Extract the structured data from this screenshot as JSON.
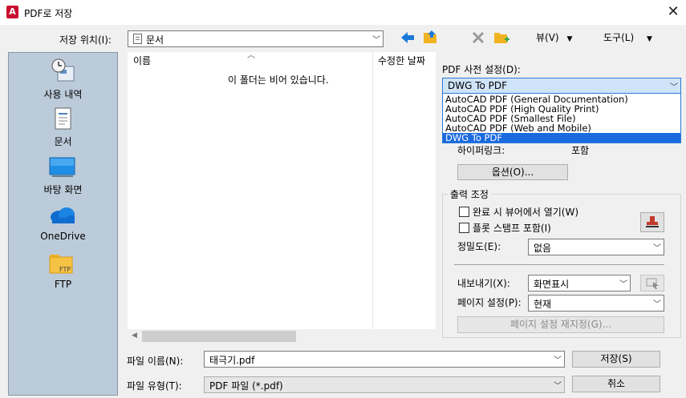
{
  "window": {
    "title": "PDF로 저장",
    "app_icon_glyph": "A",
    "close_glyph": "✕"
  },
  "location": {
    "label": "저장 위치(I):",
    "value": "문서"
  },
  "toolbar": {
    "view_label": "뷰(V)",
    "tools_label": "도구(L)"
  },
  "sidebar": {
    "items": [
      {
        "label": "사용 내역",
        "icon": "history-icon"
      },
      {
        "label": "문서",
        "icon": "documents-icon"
      },
      {
        "label": "바탕 화면",
        "icon": "desktop-icon"
      },
      {
        "label": "OneDrive",
        "icon": "onedrive-icon"
      },
      {
        "label": "FTP",
        "icon": "ftp-folder-icon"
      }
    ]
  },
  "file_list": {
    "col_name": "이름",
    "col_modified": "수정한 날짜",
    "empty_text": "이 폴더는 비어 있습니다."
  },
  "pdf_preset": {
    "label": "PDF 사전 설정(D):",
    "value": "DWG To PDF",
    "options": [
      "AutoCAD PDF (General Documentation)",
      "AutoCAD PDF (High Quality Print)",
      "AutoCAD PDF (Smallest File)",
      "AutoCAD PDF (Web and Mobile)",
      "DWG To PDF"
    ],
    "selected_index": 4
  },
  "hyperlink": {
    "label": "하이퍼링크:",
    "value": "포함"
  },
  "options_button": "옵션(O)...",
  "output": {
    "group_label": "출력 조정",
    "open_in_viewer_label": "완료 시 뷰어에서 열기(W)",
    "open_in_viewer_checked": false,
    "plot_stamp_label": "플롯 스탬프 포함(I)",
    "plot_stamp_checked": false,
    "quality_label": "정밀도(E):",
    "quality_value": "없음",
    "export_label": "내보내기(X):",
    "export_value": "화면표시",
    "page_setup_label": "페이지 설정(P):",
    "page_setup_value": "현재",
    "page_setup_override_button": "페이지 설정 재지정(G)..."
  },
  "filename": {
    "label": "파일 이름(N):",
    "value": "태극기.pdf"
  },
  "filetype": {
    "label": "파일 유형(T):",
    "value": "PDF 파일 (*.pdf)"
  },
  "buttons": {
    "save": "저장(S)",
    "cancel": "취소"
  },
  "colors": {
    "sidebar_bg": "#bccbd9",
    "selection": "#1a6ae0",
    "app_icon": "#c8102e",
    "nav_arrow": "#1a7ad8",
    "folder": "#f2b322"
  }
}
